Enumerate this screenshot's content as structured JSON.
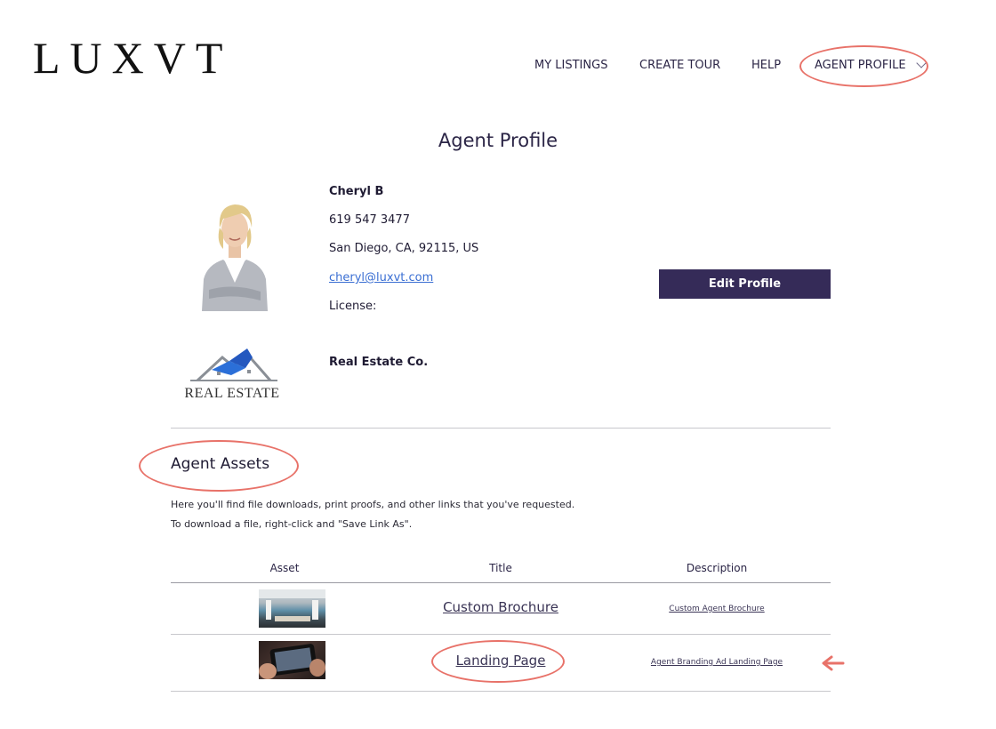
{
  "brand": {
    "logo_text": "LUXVT"
  },
  "nav": {
    "items": [
      "MY LISTINGS",
      "CREATE TOUR",
      "HELP",
      "AGENT PROFILE"
    ]
  },
  "page": {
    "title": "Agent Profile"
  },
  "profile": {
    "name": "Cheryl B",
    "phone": "619 547 3477",
    "address": "San Diego, CA, 92115, US",
    "email": "cheryl@luxvt.com",
    "license_label": "License:",
    "edit_button": "Edit Profile",
    "brokerage_logo_text": "REAL ESTATE",
    "company": "Real Estate Co."
  },
  "assets": {
    "title": "Agent Assets",
    "description_lines": [
      "Here you'll find file downloads, print proofs, and other links that you've requested.",
      "To download a file, right-click and \"Save Link As\"."
    ],
    "columns": [
      "Asset",
      "Title",
      "Description"
    ],
    "rows": [
      {
        "title": "Custom Brochure",
        "description": "Custom Agent Brochure"
      },
      {
        "title": "Landing Page",
        "description": "Agent Branding Ad Landing Page"
      }
    ]
  },
  "colors": {
    "accent": "#352b58",
    "annotation": "#e87269",
    "link": "#3b6fd3"
  }
}
